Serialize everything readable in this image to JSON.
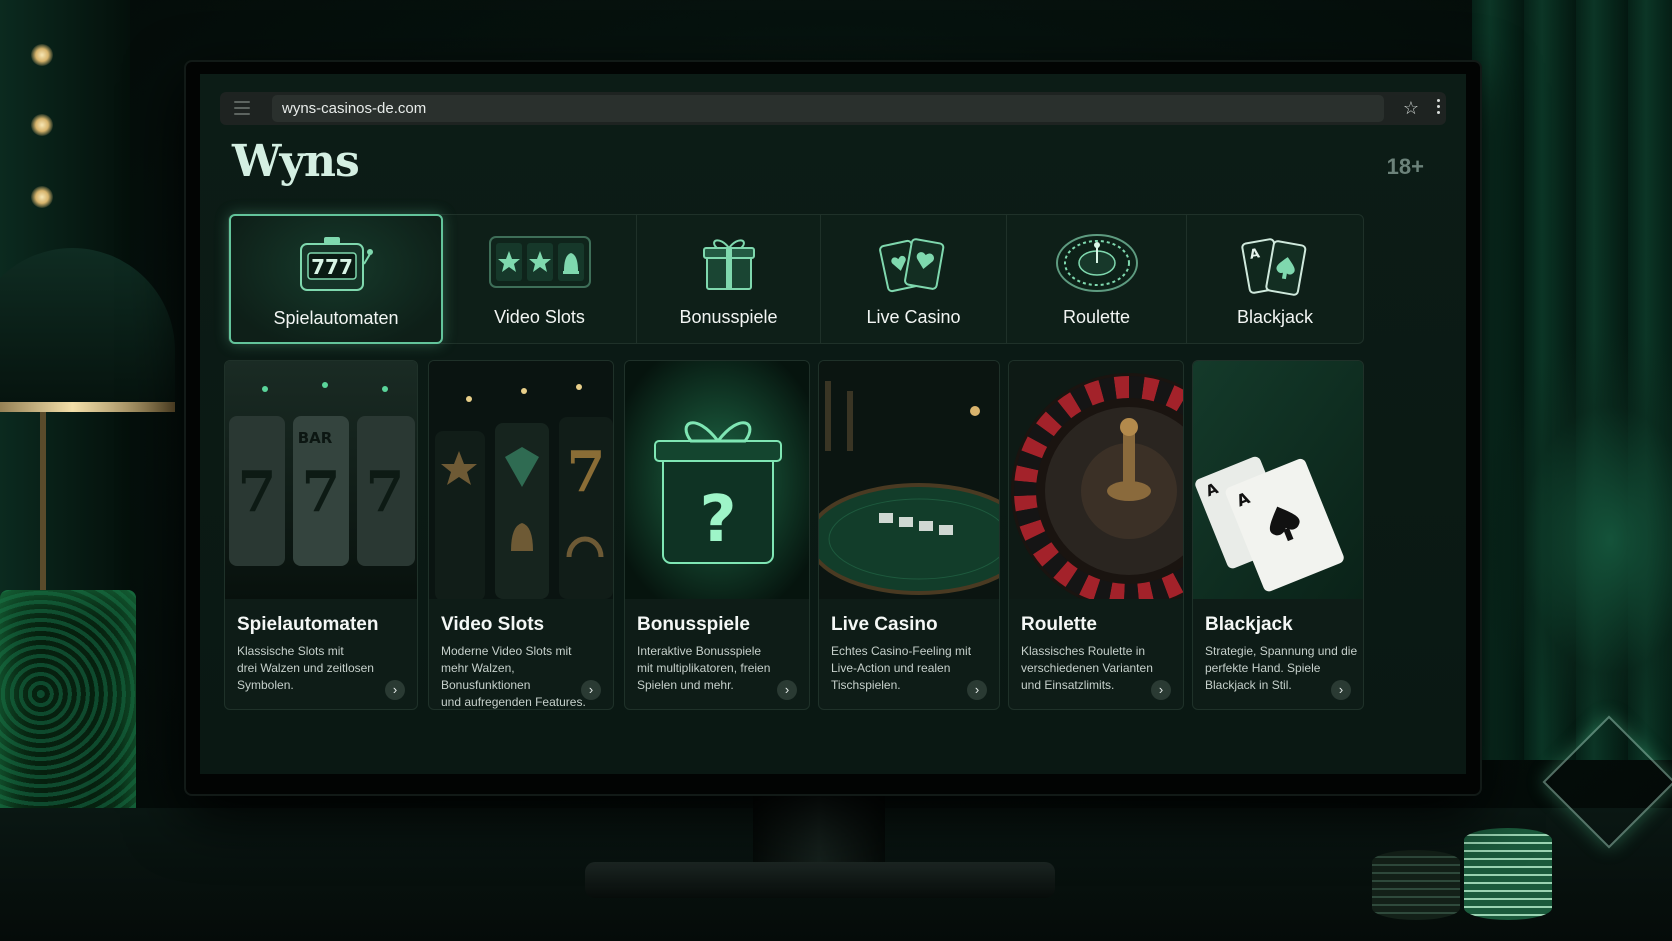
{
  "browser": {
    "url": "wyns-casinos-de.com"
  },
  "header": {
    "brand": "Wyns",
    "age_badge": "18+"
  },
  "tabs": [
    {
      "label": "Spielautomaten",
      "icon": "slot-machine-icon",
      "active": true
    },
    {
      "label": "Video Slots",
      "icon": "video-slots-icon",
      "active": false
    },
    {
      "label": "Bonusspiele",
      "icon": "gift-icon",
      "active": false
    },
    {
      "label": "Live Casino",
      "icon": "playing-cards-icon",
      "active": false
    },
    {
      "label": "Roulette",
      "icon": "roulette-wheel-icon",
      "active": false
    },
    {
      "label": "Blackjack",
      "icon": "ace-cards-icon",
      "active": false
    }
  ],
  "cards": [
    {
      "title": "Spielautomaten",
      "description": "Klassische Slots mit\ndrei Walzen und zeitlosen\nSymbolen.",
      "image": "slot-reels-777"
    },
    {
      "title": "Video Slots",
      "description": "Moderne Video Slots mit\nmehr Walzen, Bonusfunktionen\nund aufregenden Features.",
      "image": "video-slot-reels"
    },
    {
      "title": "Bonusspiele",
      "description": "Interaktive Bonusspiele\nmit multiplikatoren, freien\nSpielen und mehr.",
      "image": "mystery-gift-box"
    },
    {
      "title": "Live Casino",
      "description": "Echtes Casino-Feeling mit\nLive-Action und realen\nTischspielen.",
      "image": "live-casino-table"
    },
    {
      "title": "Roulette",
      "description": "Klassisches Roulette in\nverschiedenen Varianten\nund Einsatzlimits.",
      "image": "roulette-wheel"
    },
    {
      "title": "Blackjack",
      "description": "Strategie, Spannung und die\nperfekte Hand. Spiele\nBlackjack in Stil.",
      "image": "blackjack-aces"
    }
  ],
  "colors": {
    "accent": "#63c49b",
    "background": "#0c1c16",
    "card": "#0e1c17"
  }
}
